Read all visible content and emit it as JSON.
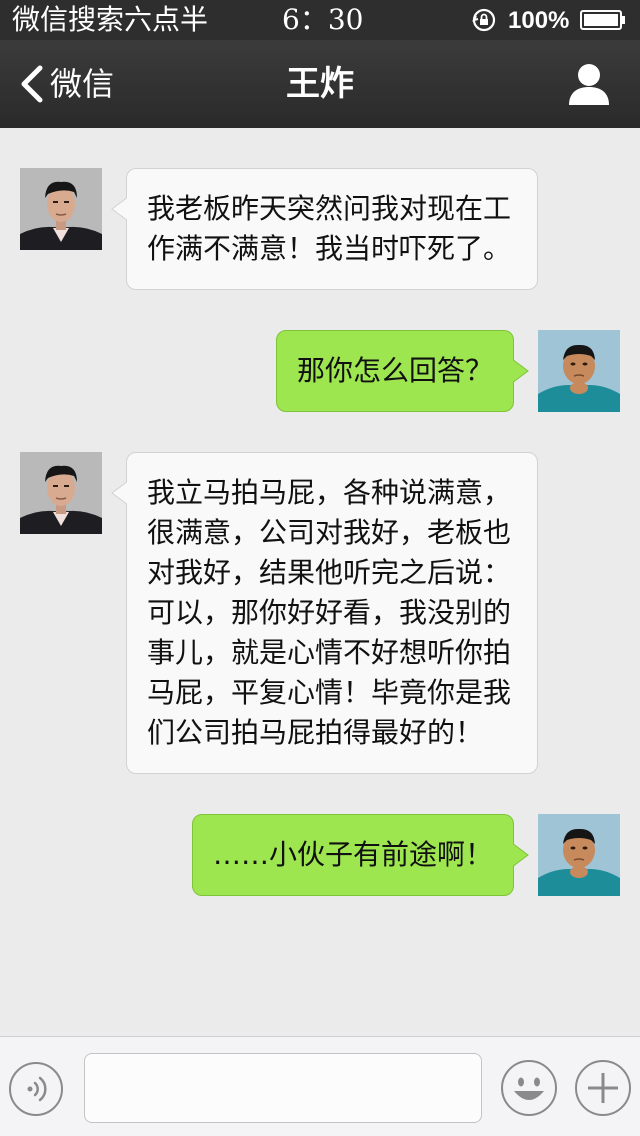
{
  "status_bar": {
    "carrier": "微信搜索六点半",
    "time": "6：30",
    "battery_percent": "100%"
  },
  "nav": {
    "back_label": "微信",
    "title": "王炸",
    "icons": {
      "back": "chevron-left-icon",
      "profile": "person-icon"
    }
  },
  "messages": [
    {
      "side": "left",
      "sender": "王炸",
      "text": "我老板昨天突然问我对现在工作满不满意！我当时吓死了。"
    },
    {
      "side": "right",
      "sender": "me",
      "text": "那你怎么回答？"
    },
    {
      "side": "left",
      "sender": "王炸",
      "text": "我立马拍马屁，各种说满意，很满意，公司对我好，老板也对我好，结果他听完之后说：可以，那你好好看，我没别的事儿，就是心情不好想听你拍马屁，平复心情！毕竟你是我们公司拍马屁拍得最好的！"
    },
    {
      "side": "right",
      "sender": "me",
      "text": "……小伙子有前途啊！"
    }
  ],
  "input_bar": {
    "placeholder": "",
    "icons": {
      "voice": "voice-icon",
      "emoji": "emoji-icon",
      "plus": "plus-icon"
    }
  },
  "colors": {
    "header": "#2e2e2f",
    "background": "#ebebeb",
    "incoming_bubble": "#f9f9f9",
    "outgoing_bubble": "#9de64f"
  }
}
